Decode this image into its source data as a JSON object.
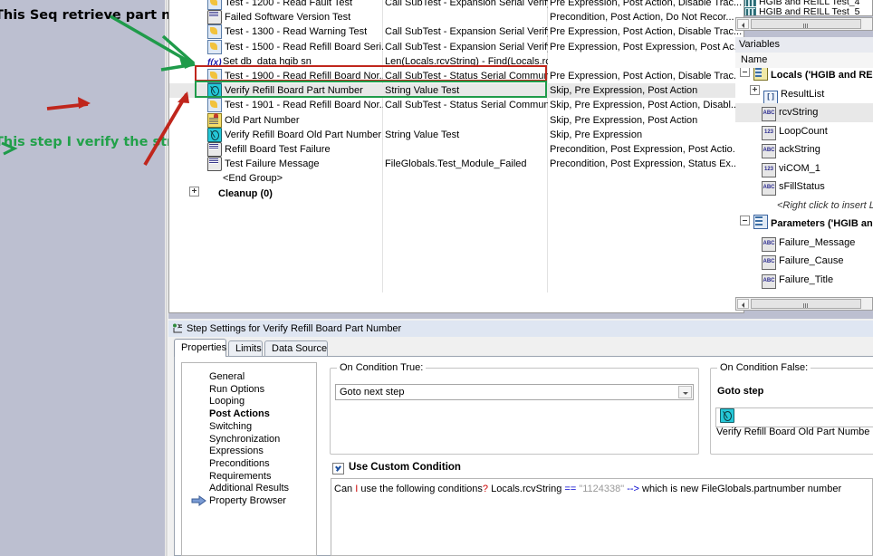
{
  "annotations": {
    "top_note": "This Seq retrieve part number",
    "bottom_note": "This step I verify the string",
    "red_box_color": "#c0261c",
    "green_box_color": "#1f9b4a",
    "red_arrow_color": "#c0261c",
    "green_arrow_color": "#1f9b4a"
  },
  "sequence_view": {
    "rows": [
      {
        "icon": "subtest-icon",
        "indent": 2,
        "name": "Test - 1200 - Read Fault Test",
        "type": "Call SubTest - Expansion Serial Verify ...",
        "settings": "Pre Expression, Post Action, Disable Trac..."
      },
      {
        "icon": "message-icon",
        "indent": 2,
        "name": "Failed Software Version Test",
        "type": "",
        "settings": "Precondition, Post Action, Do Not Recor..."
      },
      {
        "icon": "subtest-icon",
        "indent": 2,
        "name": "Test - 1300 - Read Warning Test",
        "type": "Call SubTest - Expansion Serial Verify ...",
        "settings": "Pre Expression, Post Action, Disable Trac..."
      },
      {
        "icon": "subtest-icon",
        "indent": 2,
        "name": "Test - 1500 - Read Refill Board Seri...",
        "type": "Call SubTest - Expansion Serial Verify ...",
        "settings": "Pre Expression, Post Expression, Post Ac..."
      },
      {
        "icon": "fx-icon",
        "indent": 2,
        "name": "Set db_data hgib sn",
        "type": "Len(Locals.rcvString) - Find(Locals.rc...",
        "settings": ""
      },
      {
        "icon": "subtest-icon",
        "indent": 2,
        "name": "Test - 1900 - Read Refill Board Nor...",
        "type": "Call SubTest - Status Serial Communic.",
        "settings": "Pre Expression, Post Action, Disable Trac..."
      },
      {
        "icon": "value-test-icon",
        "indent": 2,
        "name": "Verify Refill Board Part Number",
        "type": "String Value Test",
        "settings": "Skip, Pre Expression, Post Action",
        "selected": true
      },
      {
        "icon": "subtest-icon",
        "indent": 2,
        "name": "Test - 1901 - Read Refill Board Nor...",
        "type": "Call SubTest - Status Serial Communic...",
        "settings": "Skip, Pre Expression, Post Action, Disabl..."
      },
      {
        "icon": "label-icon",
        "indent": 2,
        "name": "Old Part Number",
        "type": "",
        "settings": "Skip, Pre Expression, Post Action"
      },
      {
        "icon": "value-test-icon",
        "indent": 2,
        "name": "Verify Refill Board Old Part Number",
        "type": "String Value Test",
        "settings": "Skip, Pre Expression"
      },
      {
        "icon": "message-icon",
        "indent": 2,
        "name": "Refill Board Test Failure",
        "type": "",
        "settings": "Precondition, Post Expression, Post Actio..."
      },
      {
        "icon": "message-icon",
        "indent": 2,
        "name": "Test Failure Message",
        "type": "FileGlobals.Test_Module_Failed",
        "settings": "Precondition, Post Expression, Status Ex..."
      },
      {
        "icon": "none",
        "indent": 2,
        "name": "<End Group>",
        "type": "",
        "settings": ""
      },
      {
        "icon": "none",
        "indent": 1,
        "name": "Cleanup (0)",
        "type": "",
        "settings": "",
        "bold": true,
        "expander": "plus"
      }
    ]
  },
  "sequences_list": {
    "rows": [
      {
        "icon": "seq-file-icon",
        "label": "HGIB and REILL Test_4"
      },
      {
        "icon": "seq-file-icon",
        "label": "HGIB and REILL Test_5"
      }
    ]
  },
  "variables_panel": {
    "title": "Variables",
    "column_header": "Name",
    "rows": [
      {
        "depth": 0,
        "expander": "minus",
        "icon": "locals-icon",
        "label": "Locals ('HGIB and RE",
        "bold": true
      },
      {
        "depth": 1,
        "expander": "plus",
        "icon": "array-icon",
        "label": "ResultList"
      },
      {
        "depth": 1,
        "expander": "none",
        "icon": "string-icon",
        "label": "rcvString",
        "selected": true
      },
      {
        "depth": 1,
        "expander": "none",
        "icon": "number-icon",
        "label": "LoopCount"
      },
      {
        "depth": 1,
        "expander": "none",
        "icon": "string-icon",
        "label": "ackString"
      },
      {
        "depth": 1,
        "expander": "none",
        "icon": "number-icon",
        "label": "viCOM_1"
      },
      {
        "depth": 1,
        "expander": "none",
        "icon": "string-icon",
        "label": "sFillStatus"
      },
      {
        "depth": 1,
        "expander": "none",
        "icon": "none",
        "label": "<Right click to insert Local",
        "italic": true
      },
      {
        "depth": 0,
        "expander": "minus",
        "icon": "params-icon",
        "label": "Parameters ('HGIB an",
        "bold": true
      },
      {
        "depth": 1,
        "expander": "none",
        "icon": "string-icon",
        "label": "Failure_Message"
      },
      {
        "depth": 1,
        "expander": "none",
        "icon": "string-icon",
        "label": "Failure_Cause"
      },
      {
        "depth": 1,
        "expander": "none",
        "icon": "string-icon",
        "label": "Failure_Title"
      }
    ]
  },
  "step_settings": {
    "title": "Step Settings for Verify Refill Board Part Number",
    "tabs": [
      {
        "label": "Properties",
        "active": true
      },
      {
        "label": "Limits",
        "active": false
      },
      {
        "label": "Data Source",
        "active": false
      }
    ],
    "categories": [
      {
        "label": "General",
        "active": false
      },
      {
        "label": "Run Options",
        "active": false
      },
      {
        "label": "Looping",
        "active": false
      },
      {
        "label": "Post Actions",
        "active": true
      },
      {
        "label": "Switching",
        "active": false
      },
      {
        "label": "Synchronization",
        "active": false
      },
      {
        "label": "Expressions",
        "active": false
      },
      {
        "label": "Preconditions",
        "active": false
      },
      {
        "label": "Requirements",
        "active": false
      },
      {
        "label": "Additional Results",
        "active": false
      },
      {
        "label": "Property Browser",
        "active": false
      }
    ],
    "on_condition_true": {
      "group_label": "On Condition True:",
      "value": "Goto next step"
    },
    "on_condition_false": {
      "group_label": "On Condition False:",
      "value": "Goto step",
      "target_step": "Verify Refill Board Old Part Numbe"
    },
    "custom_condition": {
      "checkbox_label": "Use Custom Condition",
      "checked": true,
      "text_parts": [
        {
          "text": "Can ",
          "style": "plain"
        },
        {
          "text": "I",
          "style": "kw"
        },
        {
          "text": " use the following conditions",
          "style": "plain"
        },
        {
          "text": "?",
          "style": "kw"
        },
        {
          "text": "  Locals.rcvString ",
          "style": "plain"
        },
        {
          "text": "==",
          "style": "op"
        },
        {
          "text": " \"1124338\"",
          "style": "lit"
        },
        {
          "text": " -->",
          "style": "op"
        },
        {
          "text": " which is new FileGlobals.partnumber number",
          "style": "plain"
        }
      ],
      "full_text": "Can I use the following conditions?  Locals.rcvString == \"1124338\" --> which is new FileGlobals.partnumber number"
    }
  }
}
